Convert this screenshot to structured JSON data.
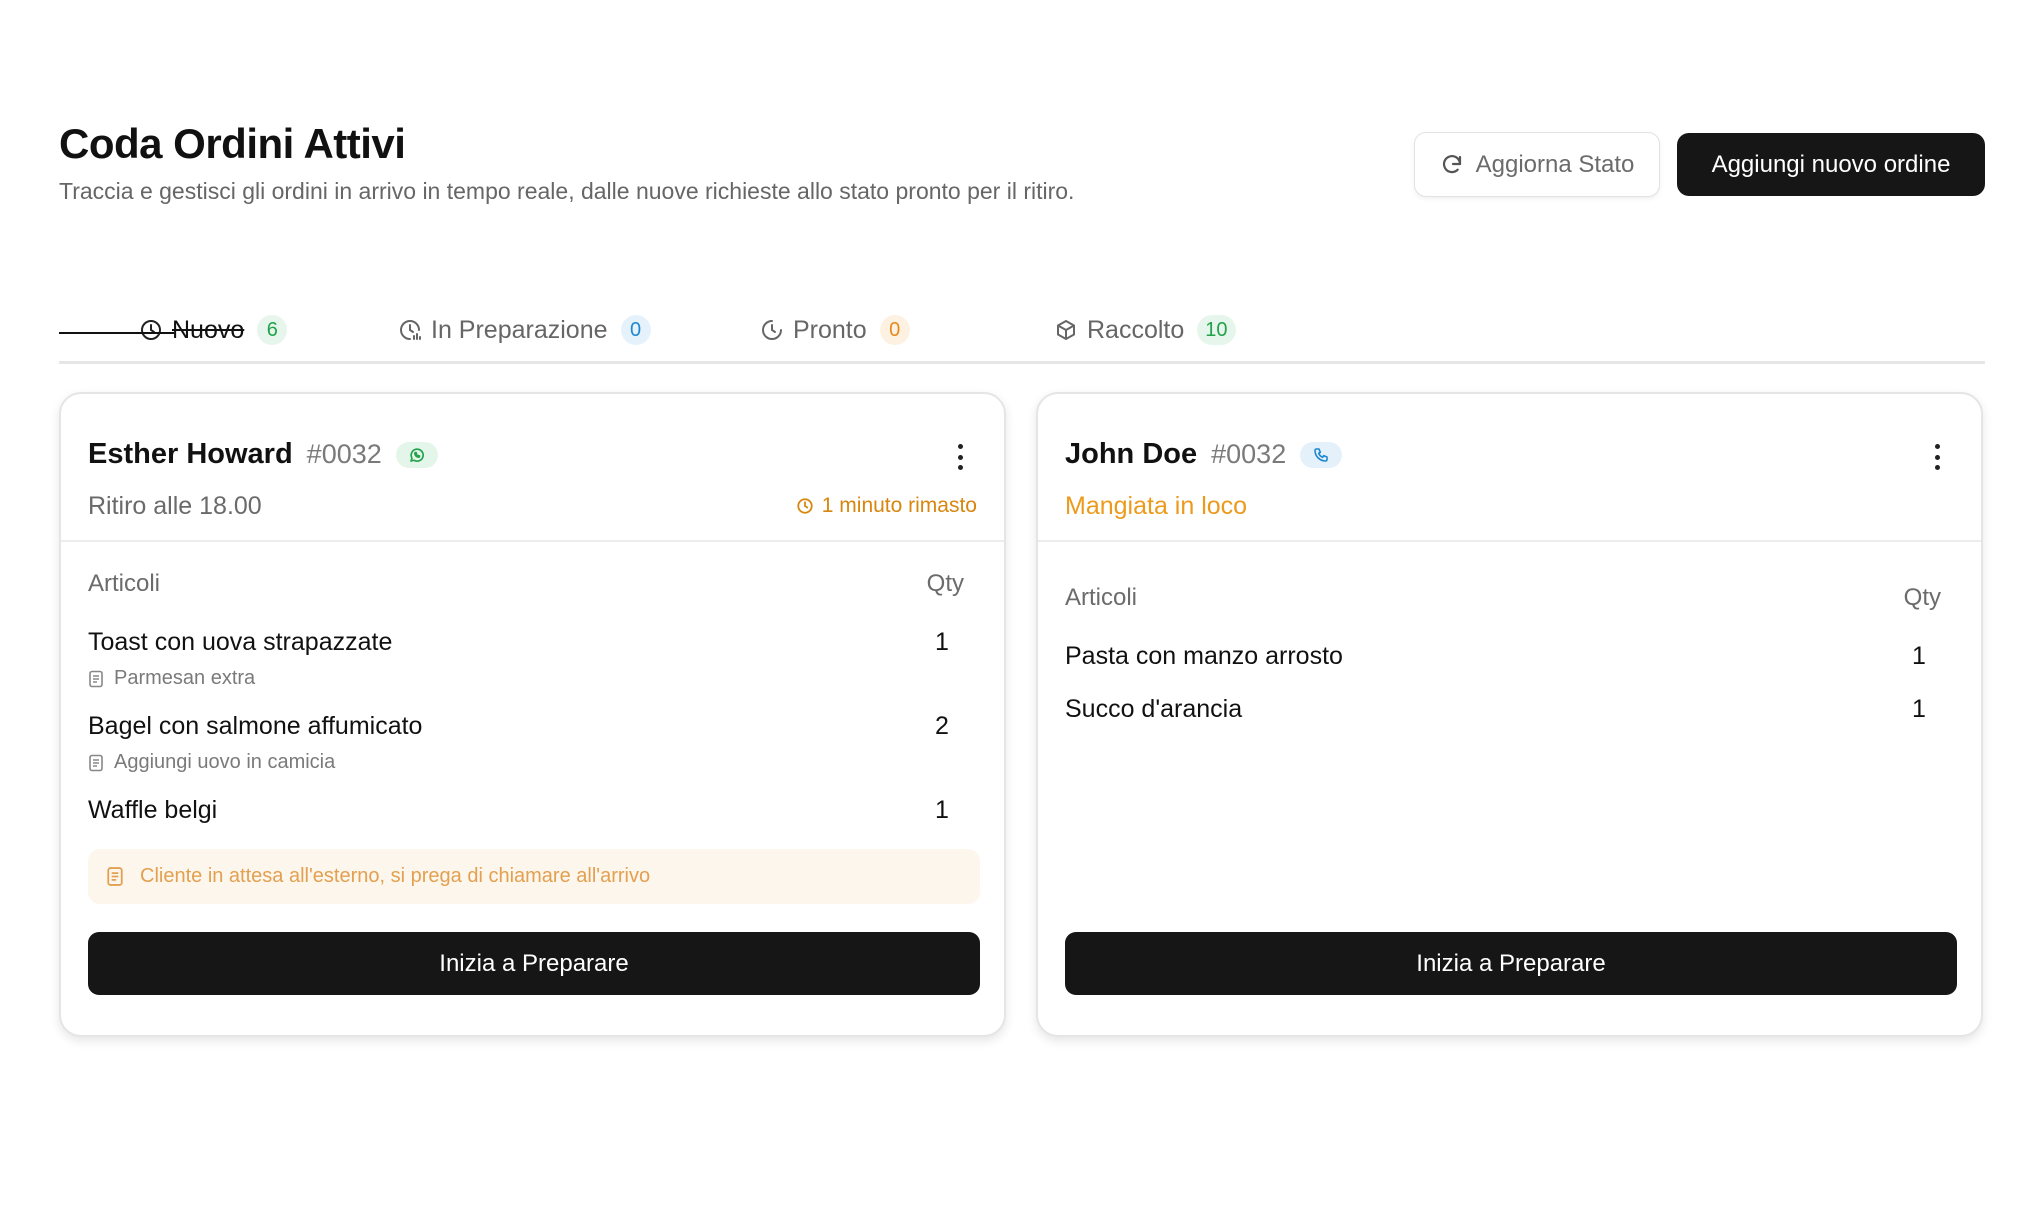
{
  "header": {
    "title": "Coda Ordini Attivi",
    "subtitle": "Traccia e gestisci gli ordini in arrivo in tempo reale, dalle nuove richieste allo stato pronto per il ritiro."
  },
  "actions": {
    "refresh_label": "Aggiorna Stato",
    "add_label": "Aggiungi nuovo ordine"
  },
  "tabs": [
    {
      "label": "Nuovo",
      "count": "6",
      "icon": "clock-icon",
      "active": true,
      "badge_color": "#22a24a"
    },
    {
      "label": "In Preparazione",
      "count": "0",
      "icon": "clock-progress-icon",
      "active": false,
      "badge_color": "#1e88d0"
    },
    {
      "label": "Pronto",
      "count": "0",
      "icon": "clock-check-icon",
      "active": false,
      "badge_color": "#e68a1e"
    },
    {
      "label": "Raccolto",
      "count": "10",
      "icon": "package-icon",
      "active": false,
      "badge_color": "#22a24a"
    }
  ],
  "orders": [
    {
      "customer": "Esther Howard",
      "order_id": "#0032",
      "channel_icon": "whatsapp-icon",
      "pickup": "Ritiro alle 18.00",
      "remaining": "1 minuto rimasto",
      "items_header": "Articoli",
      "qty_header": "Qty",
      "items": [
        {
          "name": "Toast con uova strapazzate",
          "qty": "1",
          "note": "Parmesan extra"
        },
        {
          "name": "Bagel con salmone affumicato",
          "qty": "2",
          "note": "Aggiungi uovo in camicia"
        },
        {
          "name": "Waffle belgi",
          "qty": "1"
        }
      ],
      "alert": "Cliente in attesa all'esterno, si prega di chiamare all'arrivo",
      "button": "Inizia a Preparare"
    },
    {
      "customer": "John Doe",
      "order_id": "#0032",
      "channel_icon": "phone-icon",
      "pickup": "Mangiata in loco",
      "items_header": "Articoli",
      "qty_header": "Qty",
      "items": [
        {
          "name": "Pasta con manzo arrosto",
          "qty": "1"
        },
        {
          "name": "Succo d'arancia",
          "qty": "1"
        }
      ],
      "button": "Inizia a Preparare"
    }
  ],
  "colors": {
    "primary": "#161616",
    "accent_orange": "#ec9a1c",
    "whatsapp_green": "#22a24a",
    "phone_blue": "#1e88d0"
  }
}
